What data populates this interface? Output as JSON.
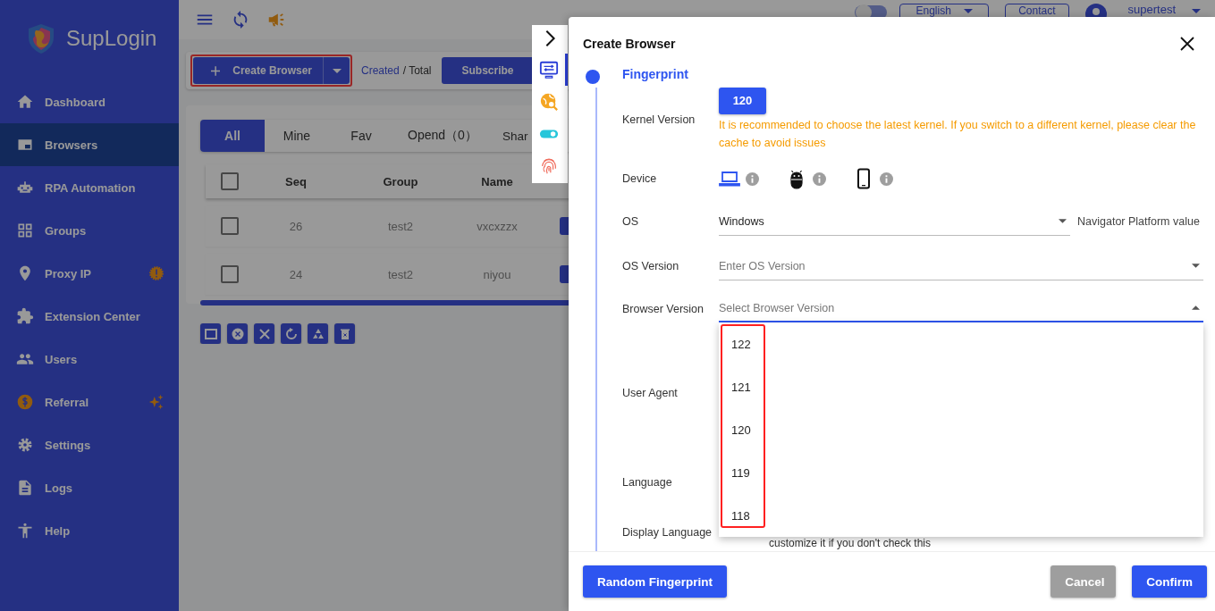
{
  "sidebar": {
    "logo": "SupLogin",
    "items": [
      {
        "label": "Dashboard",
        "selected": false
      },
      {
        "label": "Browsers",
        "selected": true
      },
      {
        "label": "RPA Automation",
        "selected": false
      },
      {
        "label": "Groups",
        "selected": false
      },
      {
        "label": "Proxy IP",
        "selected": false
      },
      {
        "label": "Extension Center",
        "selected": false
      },
      {
        "label": "Users",
        "selected": false
      },
      {
        "label": "Referral",
        "selected": false
      },
      {
        "label": "Settings",
        "selected": false
      },
      {
        "label": "Logs",
        "selected": false
      },
      {
        "label": "Help",
        "selected": false
      }
    ]
  },
  "topbar": {
    "language": "English",
    "contact": "Contact",
    "user": "supertest"
  },
  "toolbar": {
    "create_button": "Create Browser",
    "highlighted": true,
    "created_link": "Created",
    "total_label": "/ Total",
    "subscribe_button": "Subscribe"
  },
  "tabs": [
    {
      "label": "All",
      "selected": true
    },
    {
      "label": "Mine",
      "selected": false
    },
    {
      "label": "Fav",
      "selected": false
    },
    {
      "label": "Opend（0）",
      "selected": false
    },
    {
      "label": "Shar",
      "selected": false
    }
  ],
  "table": {
    "select_all_checked": false,
    "columns": [
      "Seq",
      "Group",
      "Name"
    ],
    "rows": [
      {
        "checked": false,
        "cells": [
          "26",
          "test2",
          "vxcxzzx"
        ]
      },
      {
        "checked": false,
        "cells": [
          "24",
          "test2",
          "niyou"
        ]
      }
    ]
  },
  "side_tools": [
    {
      "selected": true
    },
    {
      "selected": false
    },
    {
      "selected": false
    },
    {
      "selected": false
    }
  ],
  "dialog": {
    "title": "Create Browser",
    "step": "Fingerprint",
    "kernel_version": {
      "label": "Kernel Version",
      "value": "120",
      "warning": "It is recommended to choose the latest kernel. If you switch to a different kernel, please clear the cache to avoid issues"
    },
    "device": {
      "label": "Device",
      "options": [
        {
          "selected": true
        },
        {
          "selected": false
        },
        {
          "selected": false
        }
      ]
    },
    "os": {
      "label": "OS",
      "value": "Windows",
      "hint": "Navigator Platform value"
    },
    "os_version": {
      "label": "OS Version",
      "placeholder": "Enter OS Version"
    },
    "browser_version": {
      "label": "Browser Version",
      "placeholder": "Select Browser Version",
      "expanded": true,
      "highlighted": true,
      "options": [
        "122",
        "121",
        "120",
        "119",
        "118"
      ]
    },
    "user_agent": {
      "label": "User Agent"
    },
    "language": {
      "label": "Language"
    },
    "display_language": {
      "label": "Display Language",
      "note": "customize it if you don't check this"
    },
    "buttons": {
      "random": "Random Fingerprint",
      "cancel": "Cancel",
      "confirm": "Confirm"
    }
  }
}
